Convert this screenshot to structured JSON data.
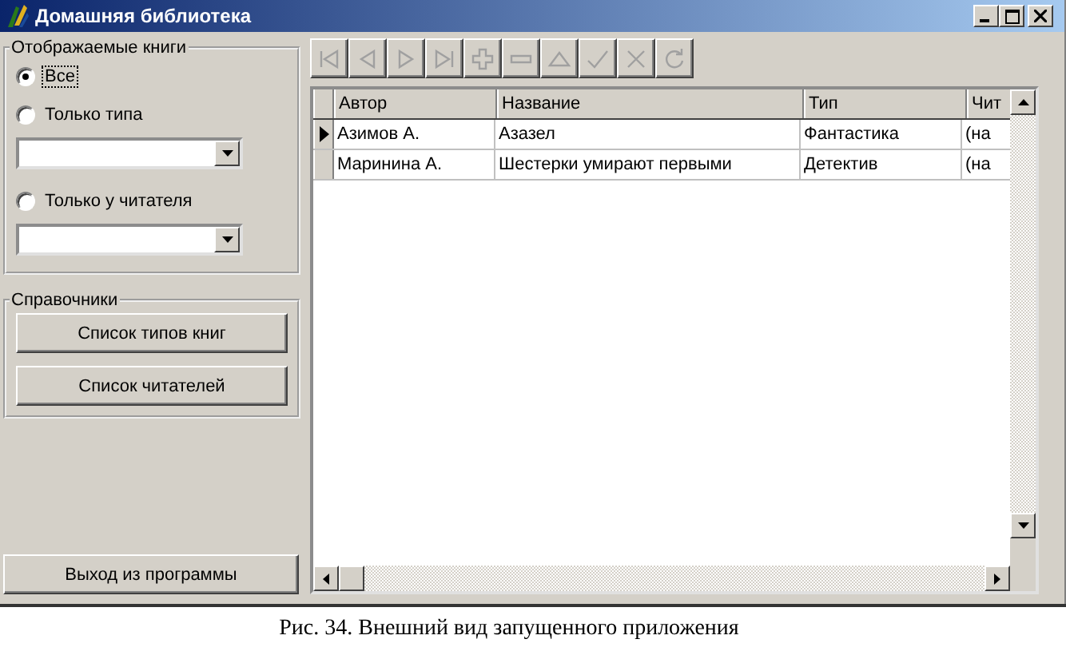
{
  "window": {
    "title": "Домашняя библиотека"
  },
  "filter": {
    "title": "Отображаемые книги",
    "items": [
      {
        "kind": "radio",
        "label": "Все",
        "selected": true,
        "focused": true
      },
      {
        "kind": "radio",
        "label": "Только типа",
        "selected": false,
        "focused": false
      },
      {
        "kind": "combo"
      },
      {
        "kind": "radio",
        "label": "Только у читателя",
        "selected": false,
        "focused": false
      },
      {
        "kind": "combo"
      }
    ]
  },
  "references": {
    "title": "Справочники",
    "buttons": [
      "Список типов книг",
      "Список читателей"
    ]
  },
  "exit_button": "Выход из программы",
  "navigator": [
    {
      "kind": "first",
      "disabled": true
    },
    {
      "kind": "prior",
      "disabled": true
    },
    {
      "kind": "next",
      "disabled": true
    },
    {
      "kind": "last",
      "disabled": true
    },
    {
      "kind": "insert",
      "disabled": true
    },
    {
      "kind": "delete",
      "disabled": true
    },
    {
      "kind": "edit",
      "disabled": true
    },
    {
      "kind": "post",
      "disabled": true
    },
    {
      "kind": "cancel",
      "disabled": true
    },
    {
      "kind": "refresh",
      "disabled": true
    }
  ],
  "table": {
    "columns": [
      "Автор",
      "Название",
      "Тип",
      "Чит"
    ],
    "rows": [
      {
        "selected": true,
        "cells": [
          "Азимов А.",
          "Азазел",
          "Фантастика",
          "(на"
        ]
      },
      {
        "selected": false,
        "cells": [
          "Маринина А.",
          "Шестерки умирают первыми",
          "Детектив",
          "(на"
        ]
      }
    ]
  },
  "caption": "Рис. 34. Внешний вид запущенного приложения"
}
